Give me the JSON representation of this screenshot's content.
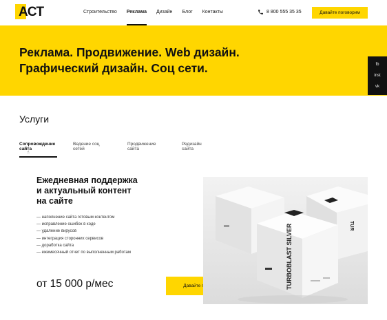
{
  "header": {
    "logo_text": "АСТ",
    "nav": [
      {
        "label": "Строительство",
        "active": false
      },
      {
        "label": "Реклама",
        "active": true
      },
      {
        "label": "Дизайн",
        "active": false
      },
      {
        "label": "Блог",
        "active": false
      },
      {
        "label": "Контакты",
        "active": false
      }
    ],
    "phone": "8 800 555 35 35",
    "cta_label": "Давайте поговорим"
  },
  "hero": {
    "title_line1": "Реклама. Продвижение. Web дизайн.",
    "title_line2": "Графический дизайн. Соц сети."
  },
  "social": [
    "fb",
    "inst",
    "vk"
  ],
  "services": {
    "title": "Услуги",
    "tabs": [
      {
        "line1": "Сопровождение",
        "line2": "сайта",
        "active": true
      },
      {
        "line1": "Ведение соц",
        "line2": "сетей",
        "active": false
      },
      {
        "line1": "Продвижение",
        "line2": "сайта",
        "active": false
      },
      {
        "line1": "Редизайн",
        "line2": "сайта",
        "active": false
      }
    ]
  },
  "card": {
    "title_line1": "Ежедневная поддержка",
    "title_line2": "и актуальный контент",
    "title_line3": "на сайте",
    "features": [
      "— наполнение сайта готовым контентом",
      "— исправление ошибок в коде",
      "— удаление вирусов",
      "— интеграция сторонних сервисов",
      "— доработка сайта",
      "— ежемесячный отчет по выполненным работам"
    ],
    "price": "от 15 000 р/мес",
    "cta_label": "Давайте поговорим",
    "product_text": "TURBOBLAST SILVER"
  },
  "colors": {
    "accent": "#FFD600",
    "dark": "#111111",
    "product_bg": "#ececec"
  }
}
